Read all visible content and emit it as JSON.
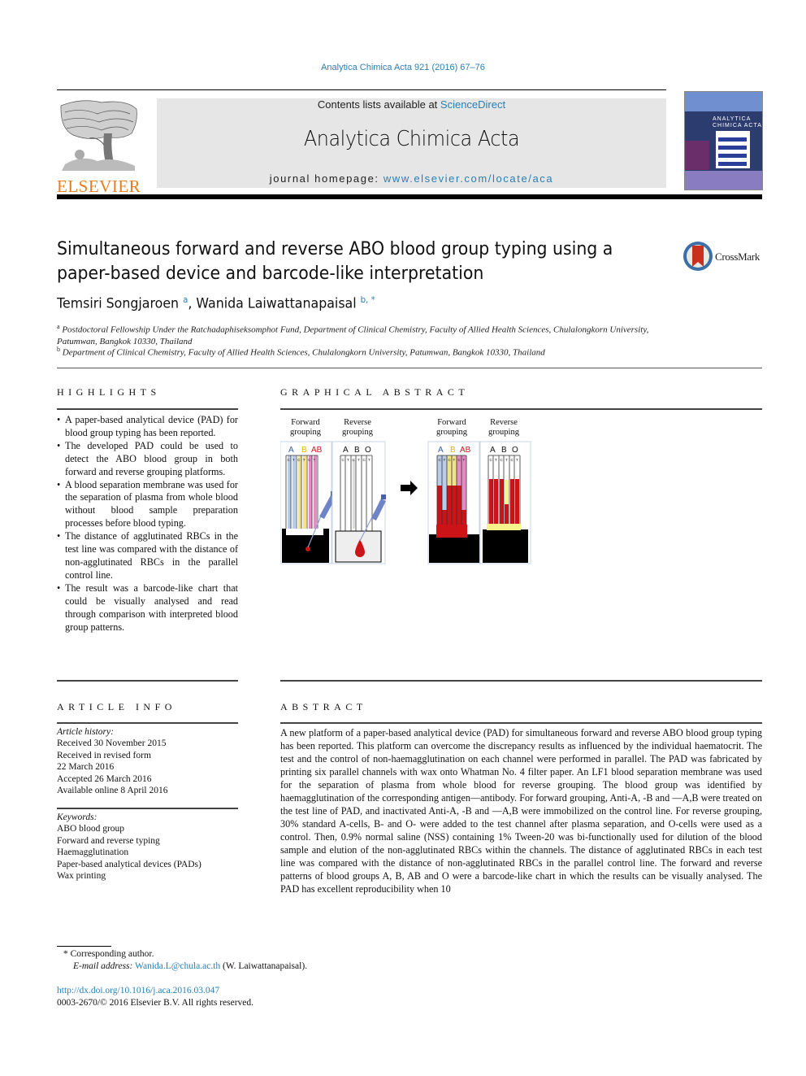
{
  "running_head": "Analytica Chimica Acta 921 (2016) 67–76",
  "publisher": {
    "logo_word": "ELSEVIER",
    "brand_color": "#e87d1e"
  },
  "masthead": {
    "contents_prefix": "Contents lists available at ",
    "contents_link": "ScienceDirect",
    "journal_title": "Analytica Chimica Acta",
    "homepage_prefix": "journal homepage: ",
    "homepage_link": "www.elsevier.com/locate/aca",
    "background": "#e6e6e6",
    "link_color": "#2a7fb5"
  },
  "cover": {
    "title_line1": "ANALYTICA",
    "title_line2": "CHIMICA ACTA"
  },
  "crossmark": {
    "label": "CrossMark"
  },
  "article": {
    "title_line1": "Simultaneous forward and reverse ABO blood group typing using a",
    "title_line2": "paper-based device and barcode-like interpretation",
    "authors": [
      {
        "name": "Temsiri Songjaroen",
        "sup": "a"
      },
      {
        "name": "Wanida Laiwattanapaisal",
        "sup": "b, *"
      }
    ],
    "author_separator": ", ",
    "affiliations": [
      {
        "sup": "a",
        "text": "Postdoctoral Fellowship Under the Ratchadaphiseksomphot Fund, Department of Clinical Chemistry, Faculty of Allied Health Sciences, Chulalongkorn University, Patumwan, Bangkok 10330, Thailand"
      },
      {
        "sup": "b",
        "text": "Department of Clinical Chemistry, Faculty of Allied Health Sciences, Chulalongkorn University, Patumwan, Bangkok 10330, Thailand"
      }
    ]
  },
  "highlights": {
    "heading": "HIGHLIGHTS",
    "items": [
      "A paper-based analytical device (PAD) for blood group typing has been reported.",
      "The developed PAD could be used to detect the ABO blood group in both forward and reverse grouping platforms.",
      "A blood separation membrane was used for the separation of plasma from whole blood without blood sample preparation processes before blood typing.",
      "The distance of agglutinated RBCs in the test line was compared with the distance of non-agglutinated RBCs in the parallel control line.",
      "The result was a barcode-like chart that could be visually analysed and read through comparison with interpreted blood group patterns."
    ]
  },
  "graphical_abstract": {
    "heading": "GRAPHICAL ABSTRACT",
    "panel_forward_label_1": "Forward",
    "panel_forward_label_2": "grouping",
    "panel_reverse_label_1": "Reverse",
    "panel_reverse_label_2": "grouping",
    "forward_groups": [
      "A",
      "B",
      "AB"
    ],
    "reverse_groups": [
      "A",
      "B",
      "O"
    ],
    "channel_letters": [
      "C",
      "T",
      "C",
      "T",
      "C",
      "T"
    ],
    "colors": {
      "anti_a": "#b9cde8",
      "anti_b": "#f2e38a",
      "anti_ab": "#e58cc4",
      "blood": "#cc1418",
      "plasma": "#f6f38a",
      "label_a": "#2f5cb8",
      "label_b": "#e0b800",
      "label_ab": "#cc1418"
    }
  },
  "article_info": {
    "heading": "ARTICLE INFO",
    "history_label": "Article history:",
    "history": [
      "Received 30 November 2015",
      "Received in revised form",
      "22 March 2016",
      "Accepted 26 March 2016",
      "Available online 8 April 2016"
    ],
    "keywords_label": "Keywords:",
    "keywords": [
      "ABO blood group",
      "Forward and reverse typing",
      "Haemagglutination",
      "Paper-based analytical devices (PADs)",
      "Wax printing"
    ]
  },
  "abstract": {
    "heading": "ABSTRACT",
    "text": "A new platform of a paper-based analytical device (PAD) for simultaneous forward and reverse ABO blood group typing has been reported. This platform can overcome the discrepancy results as influenced by the individual haematocrit. The test and the control of non-haemagglutination on each channel were performed in parallel. The PAD was fabricated by printing six parallel channels with wax onto Whatman No. 4 filter paper. An LF1 blood separation membrane was used for the separation of plasma from whole blood for reverse grouping. The blood group was identified by haemagglutination of the corresponding antigen—antibody. For forward grouping, Anti-A, -B and —A,B were treated on the test line of PAD, and inactivated Anti-A, -B and —A,B were immobilized on the control line. For reverse grouping, 30% standard A-cells, B- and O- were added to the test channel after plasma separation, and O-cells were used as a control. Then, 0.9% normal saline (NSS) containing 1% Tween-20 was bi-functionally used for dilution of the blood sample and elution of the non-agglutinated RBCs within the channels. The distance of agglutinated RBCs in each test line was compared with the distance of non-agglutinated RBCs in the parallel control line. The forward and reverse patterns of blood groups A, B, AB and O were a barcode-like chart in which the results can be visually analysed. The PAD has excellent reproducibility when 10"
  },
  "footnotes": {
    "corresponding_marker": "*",
    "corresponding_label": "Corresponding author.",
    "email_label": "E-mail address:",
    "email": "Wanida.L@chula.ac.th",
    "email_suffix": " (W. Laiwattanapaisal).",
    "doi": "http://dx.doi.org/10.1016/j.aca.2016.03.047",
    "copyright": "0003-2670/© 2016 Elsevier B.V. All rights reserved."
  }
}
